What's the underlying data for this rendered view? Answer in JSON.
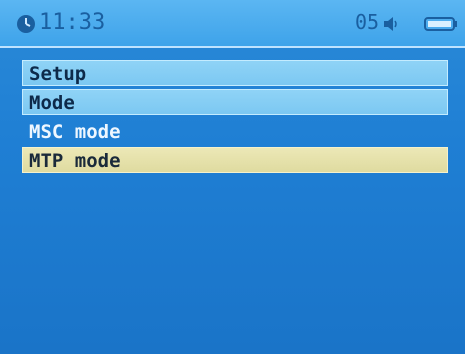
{
  "status": {
    "time": "11:33",
    "volume": "05",
    "clock_icon": "clock-icon",
    "speaker_icon": "speaker-icon",
    "battery_icon": "battery-icon"
  },
  "menu": {
    "items": [
      {
        "label": "Setup",
        "state": "header"
      },
      {
        "label": "Mode",
        "state": "header"
      },
      {
        "label": "MSC mode",
        "state": "normal"
      },
      {
        "label": "MTP mode",
        "state": "selected"
      }
    ]
  },
  "colors": {
    "background": "#1f7fd4",
    "statusbar": "#3ea3ea",
    "header_row": "#7cc8f2",
    "selected_row": "#dfdba0"
  }
}
